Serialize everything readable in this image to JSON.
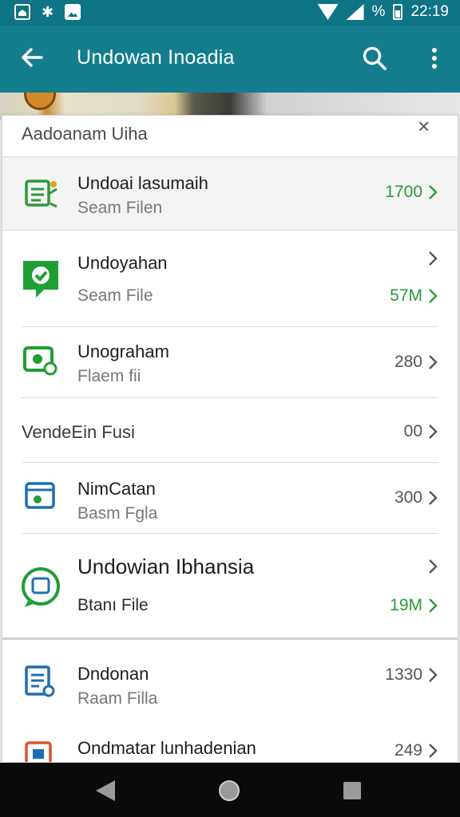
{
  "status_bar": {
    "percent": "%",
    "time": "22:19",
    "icons": [
      "home-icon",
      "bluetooth-icon",
      "image-icon",
      "wifi-icon",
      "signal-icon",
      "battery-icon"
    ]
  },
  "app_bar": {
    "title": "Undowan Inoadia",
    "icons": [
      "back-arrow-icon",
      "search-icon",
      "more-vert-icon"
    ]
  },
  "sheet": {
    "title": "Aadoanam Uiha",
    "close_glyph": "×",
    "items": [
      {
        "name": "Undoai lasumaih",
        "sub": "Seam Filen",
        "value": "1700",
        "icon": "document-list-icon",
        "value_color": "#2b9a39"
      },
      {
        "name": "Undoyahan",
        "sub": "Seam File",
        "value": "57M",
        "icon": "shield-check-icon",
        "value_color": "#2b9a39"
      },
      {
        "name": "Unograham",
        "sub": "Flaem fii",
        "value": "280",
        "icon": "screen-record-icon",
        "value_color": "#555555"
      },
      {
        "name": "VendeEin Fusi",
        "sub": "",
        "value": "00",
        "icon": "",
        "value_color": "#555555"
      },
      {
        "name": "NimCatan",
        "sub": "Basm Fgla",
        "value": "300",
        "icon": "browser-window-icon",
        "value_color": "#555555"
      },
      {
        "name": "Undowian Ibhansia",
        "sub": "Btanı File",
        "value": "19M",
        "icon": "chat-app-icon",
        "value_color": "#2b9a39"
      },
      {
        "name": "Dndonan",
        "sub": "Raam Filla",
        "value": "1330",
        "icon": "report-doc-icon",
        "value_color": "#555555"
      },
      {
        "name": "Ondmatar lunhadenian",
        "sub": "",
        "value": "249",
        "icon": "calendar-app-icon",
        "value_color": "#555555"
      }
    ]
  },
  "nav_bar": {
    "icons": [
      "nav-back-icon",
      "nav-home-icon",
      "nav-recents-icon"
    ]
  }
}
